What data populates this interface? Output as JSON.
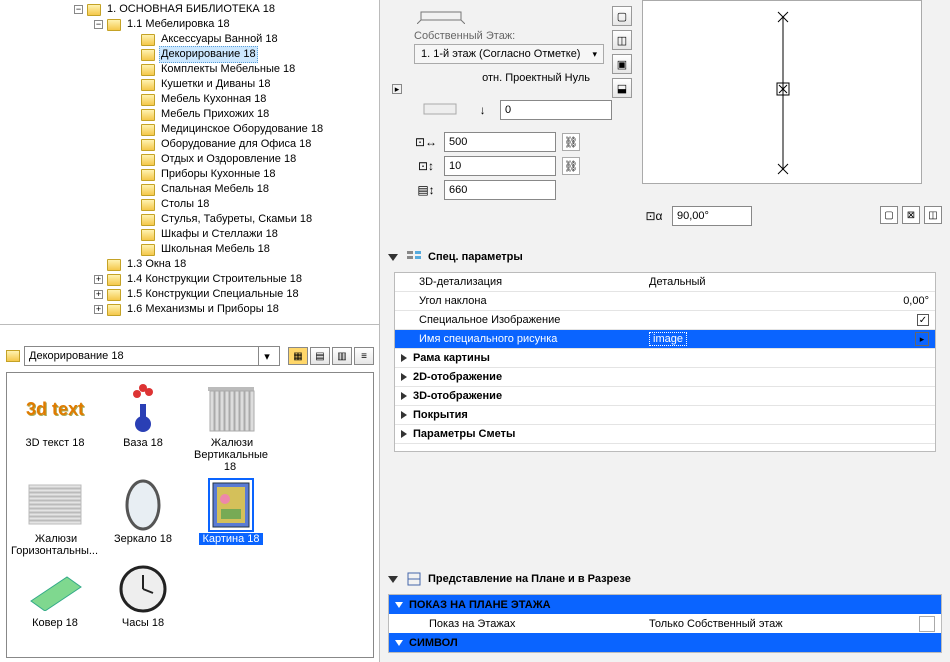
{
  "tree": {
    "root": "1. ОСНОВНАЯ БИБЛИОТЕКА 18",
    "furniture": "1.1 Мебелировка 18",
    "items": [
      "Аксессуары Ванной 18",
      "Декорирование 18",
      "Комплекты Мебельные 18",
      "Кушетки и Диваны 18",
      "Мебель Кухонная 18",
      "Мебель Прихожих 18",
      "Медицинское Оборудование 18",
      "Оборудование для Офиса 18",
      "Отдых и Оздоровление 18",
      "Приборы Кухонные 18",
      "Спальная Мебель 18",
      "Столы 18",
      "Стулья, Табуреты, Скамьи 18",
      "Шкафы и Стеллажи 18",
      "Школьная Мебель 18"
    ],
    "selected_index": 1,
    "siblings": [
      "1.3 Окна 18",
      "1.4 Конструкции Строительные 18",
      "1.5 Конструкции Специальные 18",
      "1.6 Механизмы и Приборы 18"
    ]
  },
  "path_label": "Декорирование 18",
  "gallery": [
    {
      "name": "3D текст 18",
      "kind": "3dtext"
    },
    {
      "name": "Ваза 18",
      "kind": "vase"
    },
    {
      "name": "Жалюзи Вертикальные 18",
      "kind": "blinds-v"
    },
    {
      "name": "Жалюзи Горизонтальны...",
      "kind": "blinds-h"
    },
    {
      "name": "Зеркало 18",
      "kind": "mirror"
    },
    {
      "name": "Картина 18",
      "kind": "painting",
      "selected": true
    },
    {
      "name": "Ковер 18",
      "kind": "carpet"
    },
    {
      "name": "Часы 18",
      "kind": "clock"
    }
  ],
  "placement": {
    "story_label": "Собственный Этаж:",
    "story_value": "1. 1-й этаж (Согласно Отметке)",
    "ref_label": "отн. Проектный Нуль",
    "z": "0",
    "w": "500",
    "h": "10",
    "d": "660",
    "angle": "90,00°"
  },
  "spec": {
    "title": "Спец. параметры",
    "rows": {
      "detail_k": "3D-детализация",
      "detail_v": "Детальный",
      "tilt_k": "Угол наклона",
      "tilt_v": "0,00°",
      "img_k": "Специальное Изображение",
      "name_k": "Имя специального рисунка",
      "name_v": "image"
    },
    "groups": [
      "Рама картины",
      "2D-отображение",
      "3D-отображение",
      "Покрытия",
      "Параметры Сметы"
    ]
  },
  "plan": {
    "title": "Представление на Плане и в Разрезе",
    "h1": "ПОКАЗ НА ПЛАНЕ ЭТАЖА",
    "r1k": "Показ на Этажах",
    "r1v": "Только Собственный этаж",
    "h2": "СИМВОЛ"
  }
}
